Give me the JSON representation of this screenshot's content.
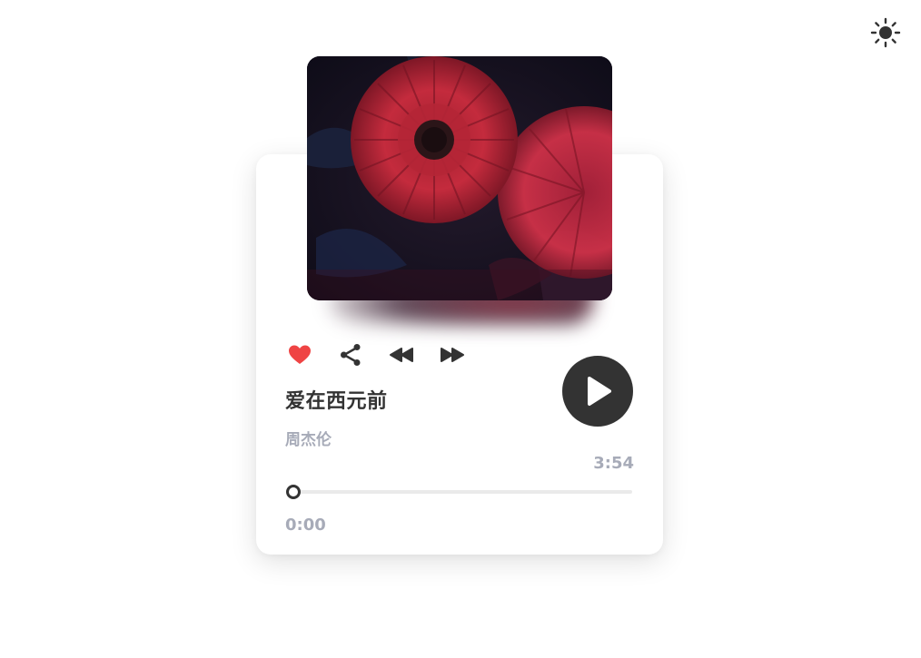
{
  "theme": {
    "toggle_icon": "sun-icon",
    "icon_color": "#333333"
  },
  "player": {
    "cover_icon": "album-cover-image",
    "actions": [
      {
        "name": "like",
        "icon": "heart-icon",
        "color": "#ef4444"
      },
      {
        "name": "share",
        "icon": "share-icon",
        "color": "#333333"
      },
      {
        "name": "previous",
        "icon": "rewind-icon",
        "color": "#333333"
      },
      {
        "name": "next",
        "icon": "fast-forward-icon",
        "color": "#333333"
      }
    ],
    "song": {
      "title": "爱在西元前",
      "artist": "周杰伦"
    },
    "play_button": {
      "icon": "play-icon",
      "background": "#333333",
      "icon_color": "#ffffff"
    },
    "progress": {
      "duration": "3:54",
      "current_time": "0:00",
      "fraction": 0.0
    }
  }
}
